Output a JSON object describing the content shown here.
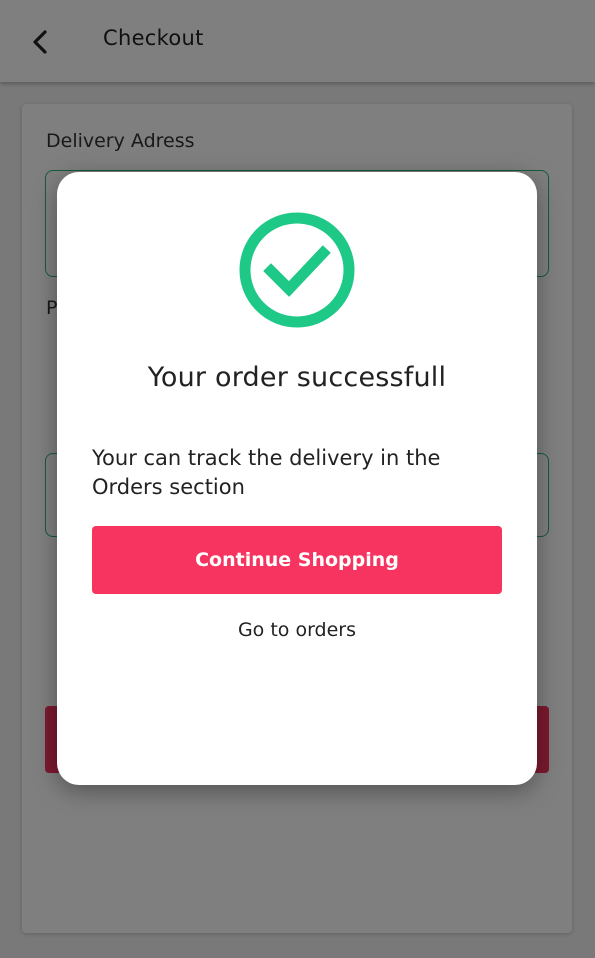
{
  "header": {
    "back_icon": "chevron-left-icon",
    "title": "Checkout"
  },
  "form": {
    "delivery_address_label": "Delivery Adress",
    "second_label_partial": "P"
  },
  "dialog": {
    "icon": "check-circle-icon",
    "icon_color": "#1ec887",
    "title": "Your order successfull",
    "message": "Your can track the delivery in the Orders section",
    "continue_label": "Continue Shopping",
    "continue_color": "#f7335f",
    "orders_link_label": "Go to orders"
  }
}
